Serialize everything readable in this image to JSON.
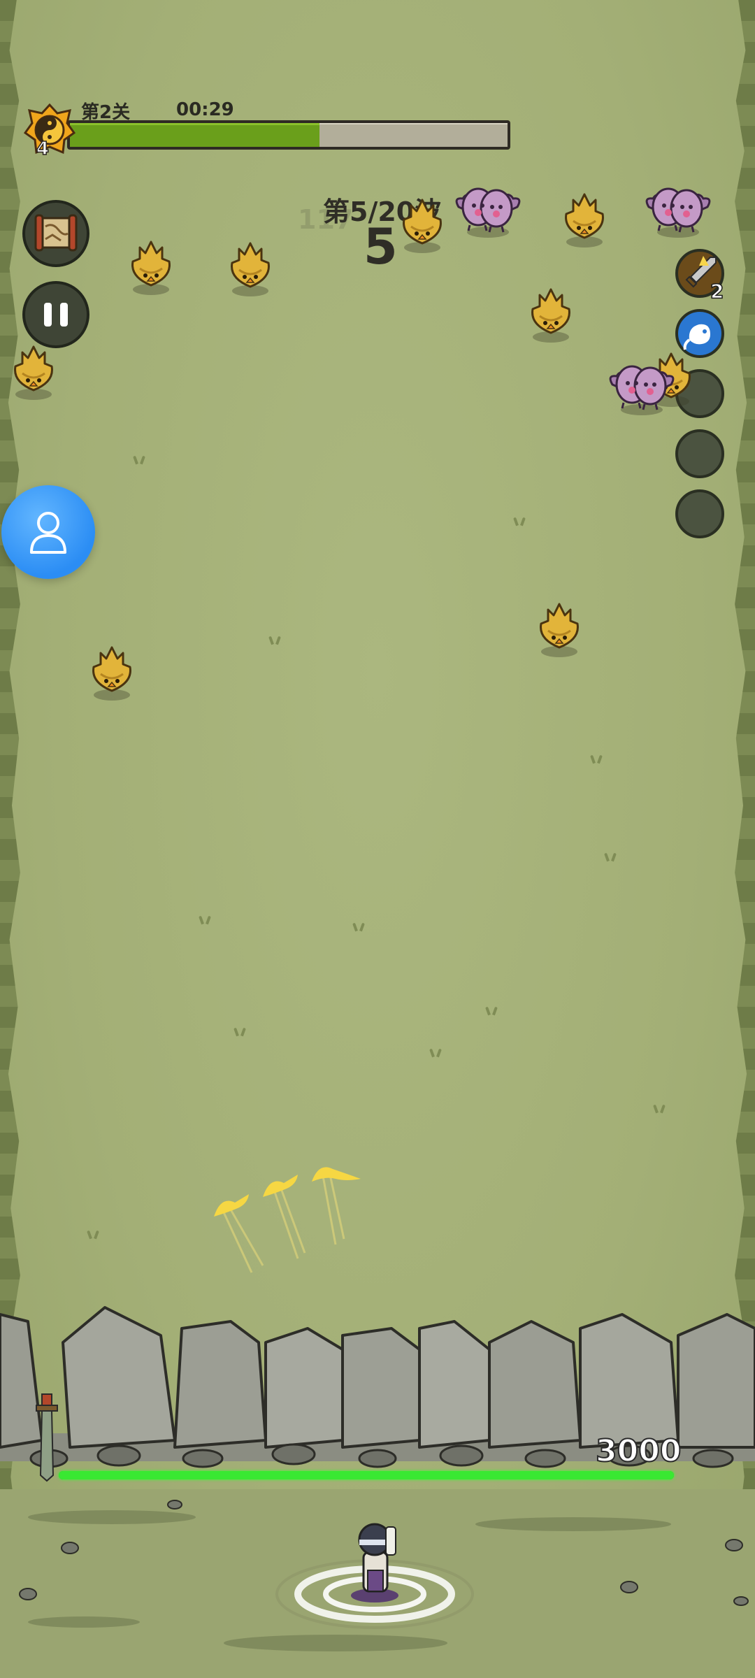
{
  "hud": {
    "stage_label": "第2关",
    "timer": "00:29",
    "player_level": "4",
    "stage_progress": 0.57
  },
  "wave": {
    "label": "第5/20波",
    "countdown": "5",
    "faded_number": "117"
  },
  "skills": {
    "slot1_count": "2",
    "slot1_icon": "sword-icon",
    "slot2_icon": "spirit-orb-icon"
  },
  "wall": {
    "hp_text": "3000",
    "hp_fraction": 1.0
  },
  "icons": {
    "map": "scroll-map-icon",
    "pause": "pause-icon",
    "profile": "user-icon"
  },
  "colors": {
    "progress_fill": "#6a9f1b",
    "hp_fill": "#39e832",
    "profile_button": "#2b8df4"
  }
}
